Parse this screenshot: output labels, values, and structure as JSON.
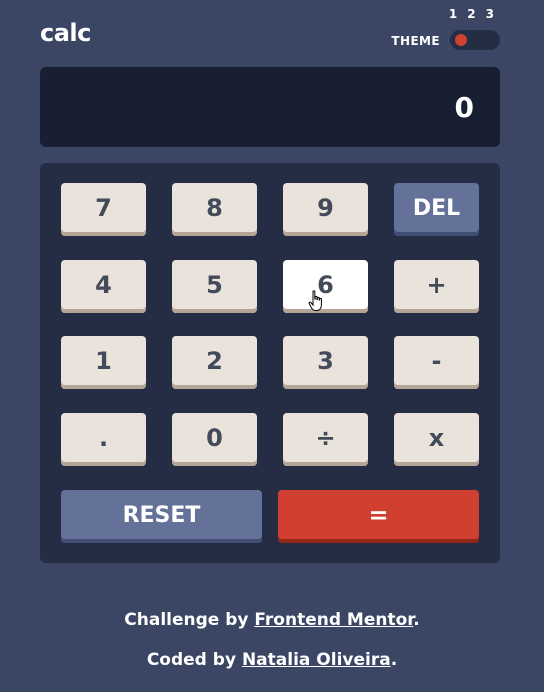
{
  "header": {
    "logo": "calc",
    "theme_label": "THEME",
    "theme_numbers": [
      "1",
      "2",
      "3"
    ],
    "theme_selected": 1
  },
  "display": {
    "value": "0"
  },
  "keypad": {
    "rows": [
      [
        "7",
        "8",
        "9",
        "DEL"
      ],
      [
        "4",
        "5",
        "6",
        "+"
      ],
      [
        "1",
        "2",
        "3",
        "-"
      ],
      [
        ".",
        "0",
        "÷",
        "x"
      ]
    ],
    "reset_label": "RESET",
    "equals_label": "="
  },
  "footer": {
    "line1_prefix": "Challenge by ",
    "line1_link": "Frontend Mentor",
    "line1_suffix": ".",
    "line2_prefix": "Coded by ",
    "line2_link": "Natalia Oliveira",
    "line2_suffix": "."
  },
  "colors": {
    "background": "#3b4664",
    "display": "#181f33",
    "keypad": "#252d44",
    "key": "#eae3dc",
    "key_blue": "#647198",
    "key_red": "#d13f30"
  },
  "icons": {
    "cursor": "hand-pointer-icon"
  }
}
